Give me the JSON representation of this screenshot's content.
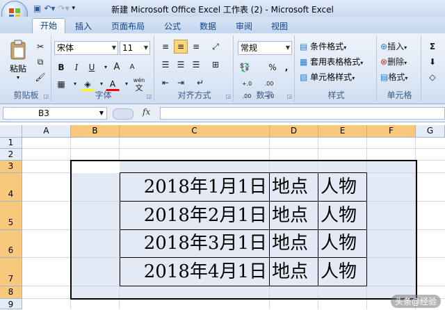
{
  "window": {
    "title": "新建 Microsoft Office Excel 工作表 (2) - Microsoft Excel"
  },
  "tabs": [
    {
      "label": "开始"
    },
    {
      "label": "插入"
    },
    {
      "label": "页面布局"
    },
    {
      "label": "公式"
    },
    {
      "label": "数据"
    },
    {
      "label": "审阅"
    },
    {
      "label": "视图"
    }
  ],
  "ribbon": {
    "clipboard": {
      "label": "剪贴板",
      "paste": "粘贴"
    },
    "font": {
      "label": "字体",
      "name": "宋体",
      "size": "11",
      "bold": "B",
      "italic": "I",
      "underline": "U",
      "grow": "A",
      "shrink": "A",
      "color": "A",
      "wen": "wén",
      "wen_char": "文"
    },
    "alignment": {
      "label": "对齐方式"
    },
    "number": {
      "label": "数字",
      "format": "常规",
      "percent": "%",
      "comma": ",",
      "inc_decimal": "+.0 .00",
      "dec_decimal": ".00 →.0"
    },
    "styles": {
      "label": "样式",
      "conditional": "条件格式",
      "table": "套用表格格式",
      "cell": "单元格样式"
    },
    "cells": {
      "label": "单元格",
      "insert": "插入",
      "delete": "删除",
      "format": "格式"
    }
  },
  "formula_bar": {
    "name_box": "B3",
    "fx": "fx",
    "value": ""
  },
  "sheet": {
    "columns": [
      "A",
      "B",
      "C",
      "D",
      "E",
      "F",
      "G"
    ],
    "rows": [
      "1",
      "2",
      "3",
      "4",
      "5",
      "6",
      "7",
      "8",
      "9"
    ],
    "data": [
      {
        "date": "2018年1月1日",
        "place": "地点",
        "person": "人物"
      },
      {
        "date": "2018年2月1日",
        "place": "地点",
        "person": "人物"
      },
      {
        "date": "2018年3月1日",
        "place": "地点",
        "person": "人物"
      },
      {
        "date": "2018年4月1日",
        "place": "地点",
        "person": "人物"
      }
    ]
  },
  "watermark": "头条@经验",
  "colors": {
    "selected_header": "#f8c87c",
    "selection_fill": "#e3e9f5",
    "ribbon": "#dbe6f5"
  }
}
